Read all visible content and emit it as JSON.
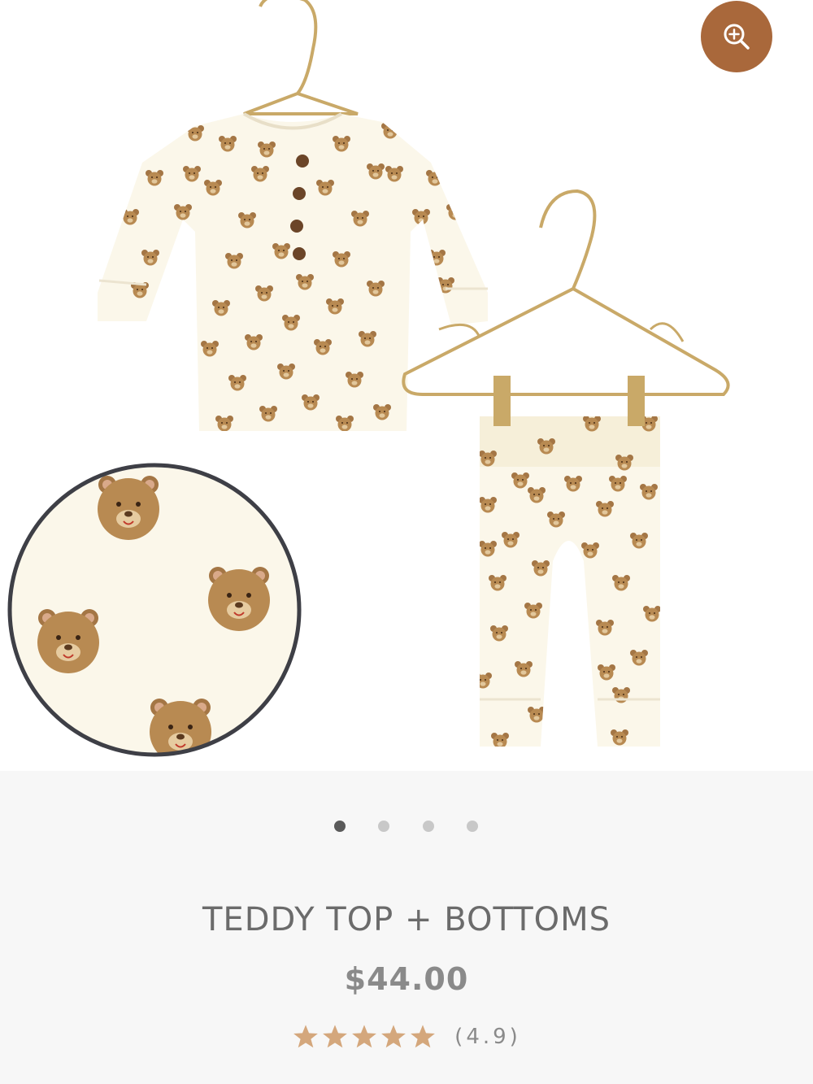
{
  "product": {
    "title": "TEDDY TOP + BOTTOMS",
    "price": "$44.00",
    "rating_text": "(4.9)",
    "rating_value": 4.9,
    "stars_count": 5
  },
  "gallery": {
    "slide_count": 4,
    "active_slide": 1,
    "zoom_icon": "zoom-in-icon",
    "image_subject": "teddy bear print two-piece pajama set on gold hangers"
  },
  "colors": {
    "accent": "#a9683b",
    "star": "#d4a77c",
    "fabric": "#fbf7ea",
    "bear": "#b88a52",
    "hanger": "#c9a968"
  }
}
